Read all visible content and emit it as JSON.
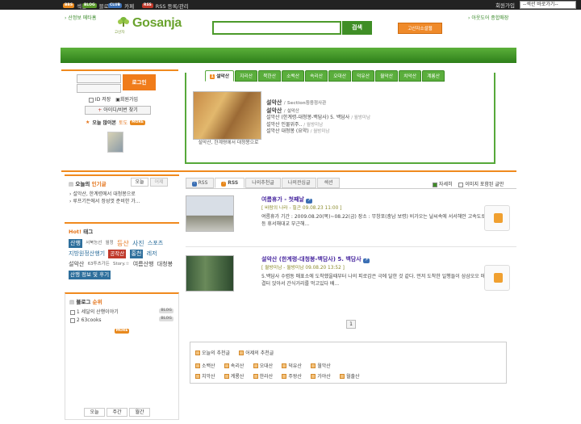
{
  "topbar": {
    "items": [
      {
        "tag": "BBS",
        "label": "섹션"
      },
      {
        "tag": "BLOG",
        "label": "블로그"
      },
      {
        "tag": "CLUB",
        "label": "카페"
      },
      {
        "tag": "RSS",
        "label": "RSS 등록/관리"
      }
    ],
    "join": "회원가입",
    "section_select": "--섹션 바로가기--"
  },
  "header": {
    "left_link": "산정보 메타홈",
    "logo_small": "고산자",
    "logo": "Gosanja",
    "search_btn": "검색",
    "site_btn": "고산자소셜웹",
    "right_link": "아웃도어 종합매장"
  },
  "login": {
    "btn": "로그인",
    "id_save": "ID 저장",
    "join": "회원가입",
    "find": "아이디/비번 찾기",
    "popular": "오늘 많이본",
    "popular_more": "토도",
    "more_tag": "MORE"
  },
  "mountain": {
    "tabs": [
      "설악산",
      "지리산",
      "북한산",
      "소백산",
      "속리산",
      "오대산",
      "덕유산",
      "월악산",
      "치악산",
      "계룡산"
    ],
    "map_caption": "설악산, 한계령에서 대청봉으로",
    "lines": [
      {
        "t": "설악산",
        "s": "/ Section등용정사관"
      },
      {
        "t": "설악산",
        "s": "/ 설악산"
      },
      {
        "t": "설악산 (한계령-대청봉-백담사) 5. 백담사",
        "s": "/ 월방미남"
      },
      {
        "t": "설악산 인물위주..",
        "s": "/ 월방미남"
      },
      {
        "t": "설악산 대청봉 (요약)",
        "s": "/ 월방미남"
      }
    ]
  },
  "left": {
    "hot_title": "오늘의",
    "hot_title2": "인기글",
    "hot_tabs": [
      "오늘",
      "어제"
    ],
    "hot_items": [
      "설악산, 한계령에서 대청봉으로",
      "루프기든에서 정성껏 준비한 가..."
    ],
    "tag_title": "Hot!",
    "tag_title2": "태그",
    "rank_title": "블로그",
    "rank_title2": "순위",
    "rank_items": [
      {
        "n": "1",
        "t": "세달의 산행이야기"
      },
      {
        "n": "2",
        "t": "63cooks"
      }
    ],
    "bottom_tabs": [
      "오늘",
      "주간",
      "월간"
    ]
  },
  "tags": [
    {
      "t": "산행",
      "c": "chip"
    },
    {
      "t": "서북능선",
      "c": "s"
    },
    {
      "t": "월정",
      "c": "s"
    },
    {
      "t": "등산",
      "c": "o"
    },
    {
      "t": "사진",
      "c": "b"
    },
    {
      "t": "스포츠",
      "c": "b"
    },
    {
      "t": "지방원정산행기",
      "c": "b"
    },
    {
      "t": "공작산",
      "c": "chip2"
    },
    {
      "t": "홍천",
      "c": "chip"
    },
    {
      "t": "레저",
      "c": "b"
    },
    {
      "t": "설악산",
      "c": "b"
    },
    {
      "t": "63투츠가든",
      "c": "s"
    },
    {
      "t": "Story.☆",
      "c": "s"
    },
    {
      "t": "여름산행",
      "c": "b"
    },
    {
      "t": "대청봉",
      "c": "b"
    },
    {
      "t": "산행 정보 및 후기",
      "c": "chip"
    }
  ],
  "feed": {
    "tabs": [
      "RSS",
      "RSS",
      "나의추천글",
      "나의관심글",
      "섹션"
    ],
    "opt1": "자세히",
    "opt2": "이미지 포함된 글만",
    "page": "1"
  },
  "posts": [
    {
      "title": "여름휴가 - 첫째날",
      "meta": "[ 바람의 나라 - 힐곤   09.08.23 11:00 ]",
      "body": "여름휴가 기간 : 2009.08.20(목)~08.22(금) 장소 : 무창포(충남 보령) 비가오는 날씨속에 서서해안 고속도로 전등 휴서해대교 부근해..."
    },
    {
      "title": "설악산 (한계령-대청봉-백담사) 5. 백담사",
      "meta": "[ 월방미남 - 월방미남   09.08.20 13:52 ]",
      "body": "5.백담사 수렴동 매표소에 도착했을때부터 나의 피로감은 극에 달한 것 같다. 먼저 도착한 일행들이 삼삼오오 매출 결터 앉아서 간식거리를 먹고있다 배..."
    }
  ],
  "recommend": {
    "row1": [
      "오늘의 추천글",
      "어제의 추천글"
    ],
    "row2": [
      "소백산",
      "속리산",
      "오대산",
      "덕유산",
      "월악산"
    ],
    "row3": [
      "치악산",
      "계룡산",
      "한라산",
      "주왕산",
      "가야산",
      "월출산"
    ]
  },
  "colors": {
    "green": "#3f8e26",
    "orange": "#f08a1e"
  }
}
